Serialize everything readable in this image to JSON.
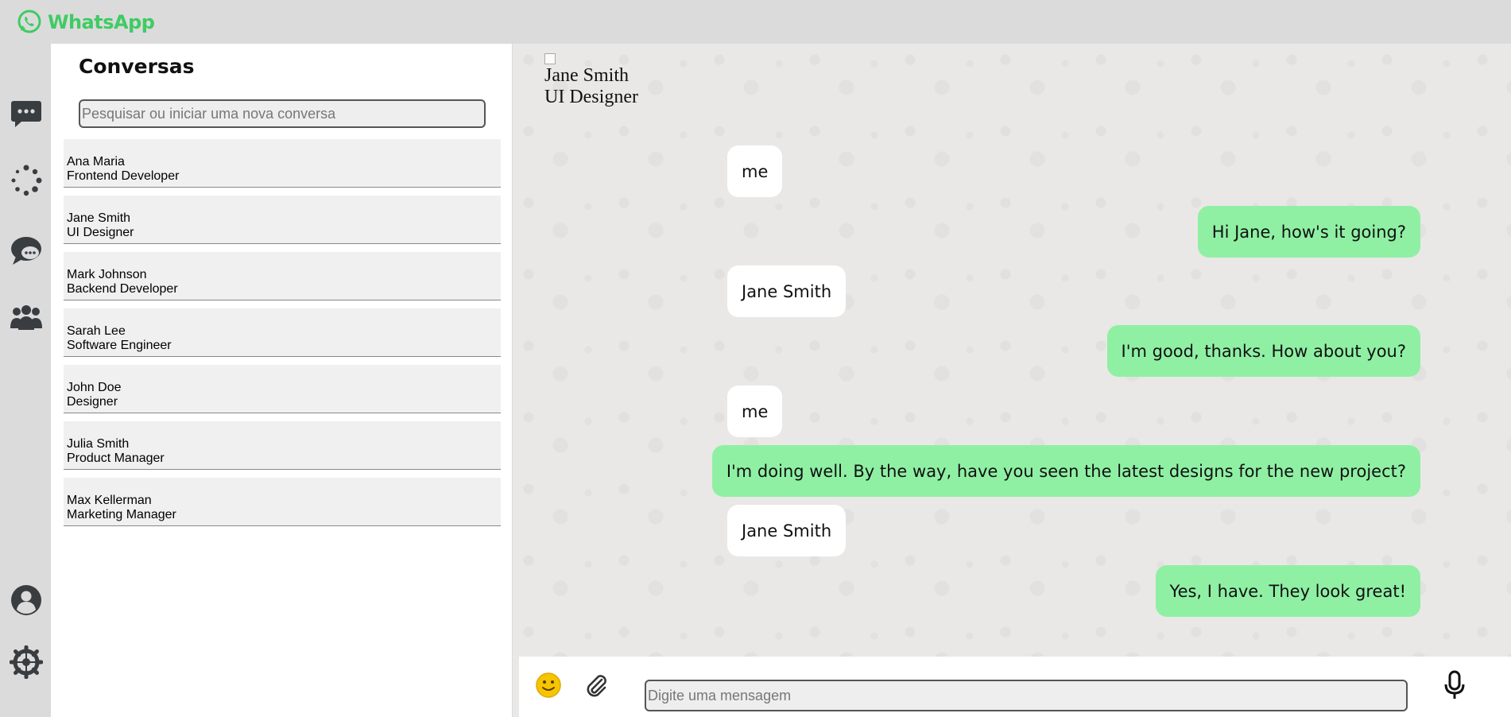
{
  "app": {
    "name": "WhatsApp",
    "brand_color": "#3fcb64"
  },
  "rail": {
    "icons": [
      "chats-icon",
      "status-icon",
      "channels-icon",
      "communities-icon",
      "profile-icon",
      "settings-icon"
    ],
    "icon_color": "#3a3d40"
  },
  "conversations": {
    "title": "Conversas",
    "search_placeholder": "Pesquisar ou iniciar uma nova conversa",
    "items": [
      {
        "name": "Ana Maria",
        "role": "Frontend Developer"
      },
      {
        "name": "Jane Smith",
        "role": "UI Designer"
      },
      {
        "name": "Mark Johnson",
        "role": "Backend Developer"
      },
      {
        "name": "Sarah Lee",
        "role": "Software Engineer"
      },
      {
        "name": "John Doe",
        "role": "Designer"
      },
      {
        "name": "Julia Smith",
        "role": "Product Manager"
      },
      {
        "name": "Max Kellerman",
        "role": "Marketing Manager"
      }
    ]
  },
  "chat": {
    "contact_name": "Jane Smith",
    "contact_role": "UI Designer",
    "messages": [
      {
        "direction": "in",
        "text": "me"
      },
      {
        "direction": "out",
        "text": "Hi Jane, how's it going?"
      },
      {
        "direction": "in",
        "text": "Jane Smith"
      },
      {
        "direction": "out",
        "text": "I'm good, thanks. How about you?"
      },
      {
        "direction": "in",
        "text": "me"
      },
      {
        "direction": "out",
        "text": "I'm doing well. By the way, have you seen the latest designs for the new project?"
      },
      {
        "direction": "in",
        "text": "Jane Smith"
      },
      {
        "direction": "out",
        "text": "Yes, I have. They look great!"
      }
    ],
    "outgoing_color": "#8ff0a4",
    "incoming_color": "#ffffff"
  },
  "composer": {
    "placeholder": "Digite uma mensagem",
    "icons": [
      "emoji-icon",
      "attach-icon",
      "microphone-icon"
    ]
  }
}
